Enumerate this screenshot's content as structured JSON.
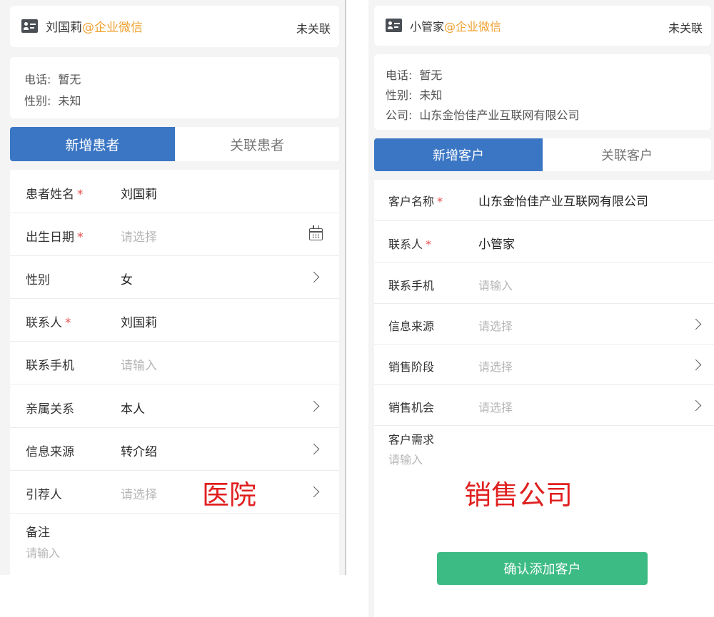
{
  "left": {
    "contact": {
      "name": "刘国莉",
      "corp": "@企业微信",
      "status": "未关联"
    },
    "info": [
      {
        "key": "电话:",
        "value": "暂无"
      },
      {
        "key": "性别:",
        "value": "未知"
      }
    ],
    "tabs": {
      "active": "新增患者",
      "other": "关联患者"
    },
    "fields": [
      {
        "label": "患者姓名",
        "required": "*",
        "value": "刘国莉"
      },
      {
        "label": "出生日期",
        "required": "*",
        "value": "请选择",
        "icon": "calendar-icon"
      },
      {
        "label": "性别",
        "value": "女",
        "icon": "chevron-right-icon"
      },
      {
        "label": "联系人",
        "required": "*",
        "value": "刘国莉"
      },
      {
        "label": "联系手机",
        "value": "请输入"
      },
      {
        "label": "亲属关系",
        "value": "本人",
        "icon": "chevron-right-icon"
      },
      {
        "label": "信息来源",
        "value": "转介绍",
        "icon": "chevron-right-icon"
      },
      {
        "label": "引荐人",
        "value": "请选择",
        "icon": "chevron-right-icon"
      }
    ],
    "remark": {
      "label": "备注",
      "placeholder": "请输入"
    },
    "caption": "医院"
  },
  "right": {
    "contact": {
      "name": "小管家",
      "corp": "@企业微信",
      "status": "未关联"
    },
    "info": [
      {
        "key": "电话:",
        "value": "暂无"
      },
      {
        "key": "性别:",
        "value": "未知"
      },
      {
        "key": "公司:",
        "value": "山东金怡佳产业互联网有限公司"
      }
    ],
    "tabs": {
      "active": "新增客户",
      "other": "关联客户"
    },
    "fields": [
      {
        "label": "客户名称",
        "required": "*",
        "value": "山东金怡佳产业互联网有限公司"
      },
      {
        "label": "联系人",
        "required": "*",
        "value": "小管家"
      },
      {
        "label": "联系手机",
        "value": "请输入"
      },
      {
        "label": "信息来源",
        "value": "请选择",
        "icon": "chevron-right-icon"
      },
      {
        "label": "销售阶段",
        "value": "请选择",
        "icon": "chevron-right-icon"
      },
      {
        "label": "销售机会",
        "value": "请选择",
        "icon": "chevron-right-icon"
      }
    ],
    "need": {
      "label": "客户需求",
      "placeholder": "请输入"
    },
    "caption": "销售公司",
    "confirm_label": "确认添加客户"
  },
  "colors": {
    "primary": "#3b76c4",
    "corp": "#f0a030",
    "required": "#e55050",
    "confirm": "#3dbb84",
    "caption": "#e02020"
  }
}
